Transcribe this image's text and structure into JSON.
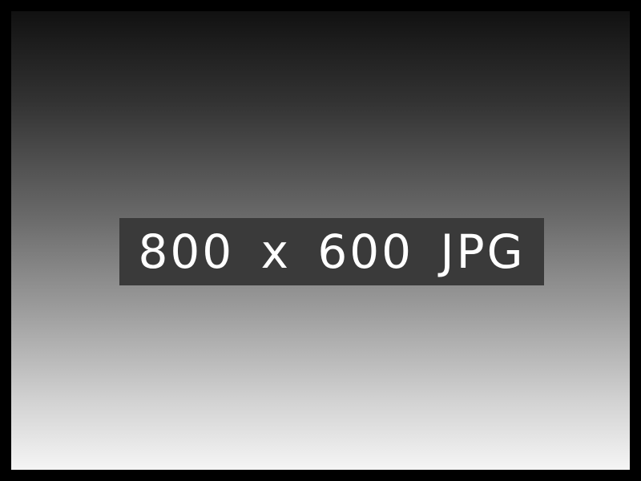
{
  "placeholder": {
    "label": "800 x 600 JPG"
  },
  "colors": {
    "border": "#000000",
    "gradient_top": "#111111",
    "gradient_bottom": "#f5f5f5",
    "label_background": "#3a3a3a",
    "label_text": "#ffffff"
  }
}
